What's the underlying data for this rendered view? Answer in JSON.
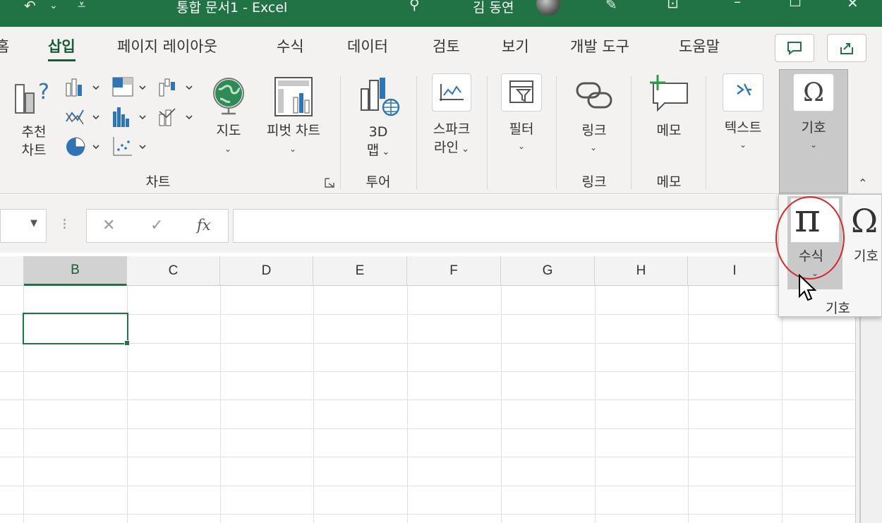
{
  "title_bar": {
    "document_title": "통합 문서1  -  Excel",
    "user_name": "김 동연"
  },
  "tabs": [
    {
      "label": "홈"
    },
    {
      "label": "삽입",
      "active": true
    },
    {
      "label": "페이지 레이아웃"
    },
    {
      "label": "수식"
    },
    {
      "label": "데이터"
    },
    {
      "label": "검토"
    },
    {
      "label": "보기"
    },
    {
      "label": "개발 도구"
    },
    {
      "label": "도움말"
    }
  ],
  "ribbon": {
    "recommended_charts": {
      "line1": "추천",
      "line2": "차트"
    },
    "maps": "지도",
    "pivot_chart": "피벗 차트",
    "map3d": {
      "line1": "3D",
      "line2": "맵"
    },
    "sparkline": {
      "line1": "스파크",
      "line2": "라인"
    },
    "filter": "필터",
    "link": "링크",
    "memo": "메모",
    "text": "텍스트",
    "symbols": "기호",
    "group_labels": {
      "charts": "차트",
      "tour": "투어",
      "links": "링크",
      "comments": "메모"
    }
  },
  "formula_bar": {
    "name_box_value": "",
    "fx_label": "fx",
    "formula_value": ""
  },
  "columns": [
    "B",
    "C",
    "D",
    "E",
    "F",
    "G",
    "H",
    "I"
  ],
  "selected_cell": "B2",
  "symbols_popup": {
    "equation_label": "수식",
    "symbol_label": "기호",
    "group_label": "기호",
    "equation_glyph": "π",
    "symbol_glyph": "Ω"
  },
  "colors": {
    "excel_green": "#217346",
    "active_tab": "#185c37",
    "highlight_circle": "#d42a2a"
  }
}
